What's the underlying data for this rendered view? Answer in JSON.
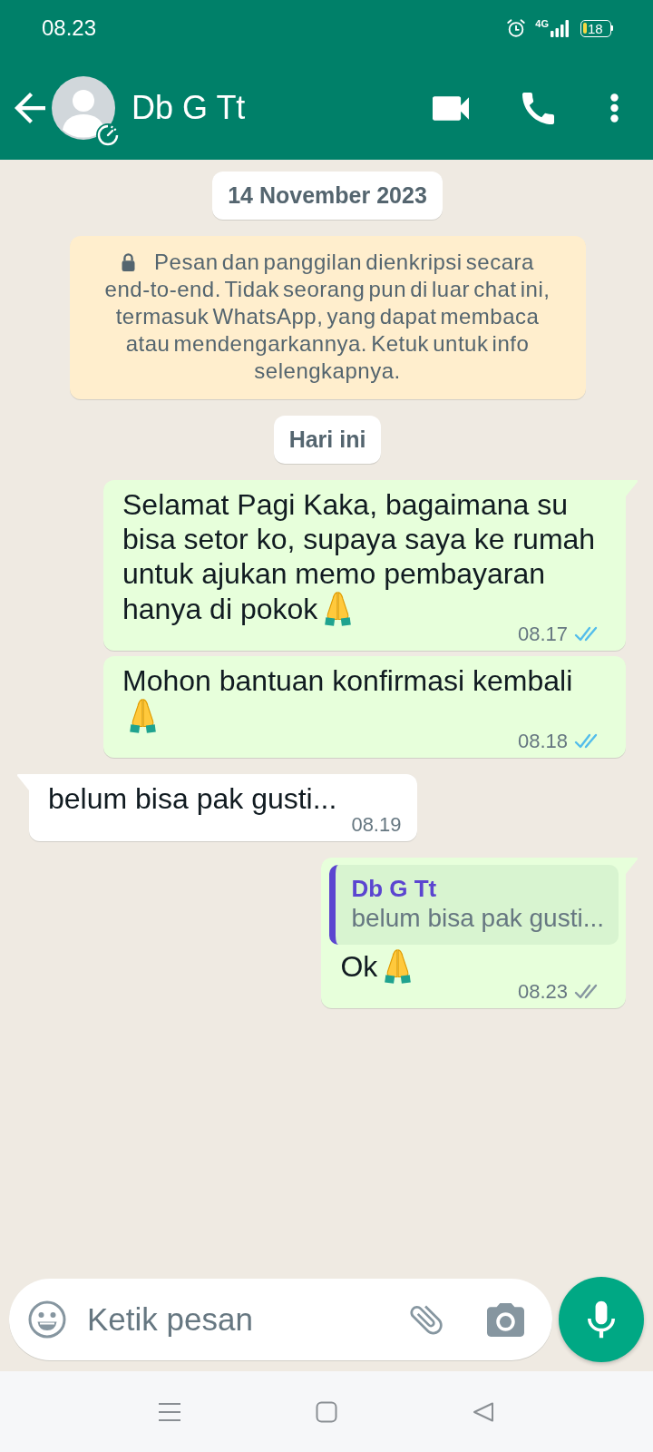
{
  "status_bar": {
    "time": "08.23",
    "network": "4G",
    "battery": "18"
  },
  "header": {
    "contact_name": "Db G Tt"
  },
  "chat": {
    "items": [
      {
        "kind": "date",
        "text": "14 November 2023"
      },
      {
        "kind": "notice",
        "text": "Pesan dan panggilan dienkripsi secara end-to-end. Tidak seorang pun di luar chat ini, termasuk WhatsApp, yang dapat membaca atau mendengarkannya. Ketuk untuk info selengkapnya."
      },
      {
        "kind": "date",
        "text": "Hari ini"
      },
      {
        "kind": "outgoing",
        "text": "Selamat Pagi Kaka, bagaimana su bisa setor ko, supaya saya ke rumah untuk ajukan memo pembayaran hanya di pokok",
        "emoji": true,
        "time": "08.17",
        "read": true
      },
      {
        "kind": "outgoing",
        "text": "Mohon bantuan konfirmasi kembali",
        "emoji": true,
        "time": "08.18",
        "read": true
      },
      {
        "kind": "incoming",
        "text": "belum bisa pak gusti...",
        "emoji": false,
        "time": "08.19"
      },
      {
        "kind": "outgoing",
        "quote": {
          "name": "Db G Tt",
          "text": "belum bisa pak gusti..."
        },
        "text": "Ok",
        "emoji": true,
        "time": "08.23",
        "read": false
      }
    ]
  },
  "composer": {
    "placeholder": "Ketik pesan"
  }
}
